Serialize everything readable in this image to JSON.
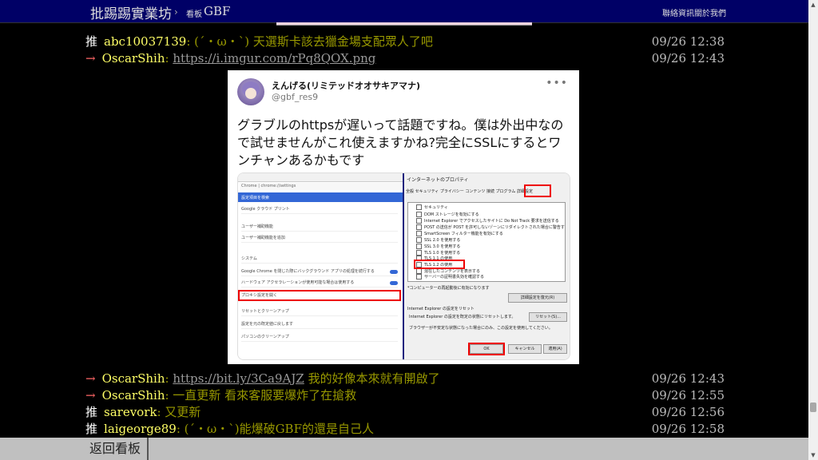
{
  "topbar": {
    "board_title": "批踢踢實業坊",
    "separator": "›",
    "board_label": "看板",
    "board_name": "GBF",
    "links": {
      "contact": "聯絡資訊",
      "about": "關於我們"
    }
  },
  "pushes_top": [
    {
      "tag": "推",
      "user": "abc10037139",
      "content": ": (´・ω・`) 天選斯卡該去獵金場支配眾人了吧",
      "time": "09/26 12:38"
    },
    {
      "tag": "→",
      "user": "OscarShih",
      "content": "https://i.imgur.com/rPq8QOX.png",
      "time": "09/26 12:43"
    }
  ],
  "tweet": {
    "display_name": "えんげる(リミテッドオオサキアマナ)",
    "handle": "@gbf_res9",
    "more_icon": "more-horizontal-icon",
    "text": "グラブルのhttpsが遅いって話題ですね。僕は外出中なので試せませんがこれ使えますかね?完全にSSLにするとワンチャンあるかもです",
    "screenshot": {
      "left_url": "Chrome | chrome://settings",
      "left_rows": [
        "設定項目を検索",
        "Google クラウド プリント",
        "ユーザー補助機能",
        "ユーザー補助機能を追加",
        "システム",
        "Google Chrome を閉じた際にバックグラウンド アプリの処理を続行する",
        "ハードウェア アクセラレーションが使用可能な場合は使用する",
        "プロキシ設定を開く",
        "リセットとクリーンアップ",
        "設定を元の既定値に戻します",
        "パソコンのクリーンアップ"
      ],
      "dialog_title": "インターネットのプロパティ",
      "tabs": "全般  セキュリティ  プライバシー  コンテンツ  接続  プログラム  詳細設定",
      "options": [
        "セキュリティ",
        "DOM ストレージを有効にする",
        "Internet Explorer でアクセスしたサイトに Do Not Track 要求を送信する",
        "POST の送信が POST を許可しないゾーンにリダイレクトされた場合に警告する",
        "SmartScreen フィルター機能を有効にする",
        "SSL 2.0 を使用する",
        "SSL 3.0 を使用する",
        "TLS 1.0 を使用する",
        "TLS 1.1 の使用",
        "TLS 1.2 の使用",
        "混在したコンテンツを表示する",
        "サーバーの証明書失効を確認する"
      ],
      "note": "*コンピューターの再起動後に有効になります",
      "restore_button": "詳細設定を復元(R)",
      "reset_heading": "Internet Explorer の設定をリセット",
      "reset_text": "Internet Explorer の設定を既定の状態にリセットします。",
      "reset_button": "リセット(S)...",
      "reset_warning": "ブラウザーが不安定な状態になった場合にのみ、この設定を使用してください。",
      "ok_button": "OK",
      "cancel_button": "キャンセル",
      "apply_button": "適用(A)"
    }
  },
  "pushes_bottom": [
    {
      "tag": "→",
      "user": "OscarShih",
      "link": "https://bit.ly/3Ca9AJZ",
      "content": " 我的好像本來就有開啟了",
      "time": "09/26 12:43"
    },
    {
      "tag": "→",
      "user": "OscarShih",
      "content": ": 一直更新 看來客服要爆炸了在搶救",
      "time": "09/26 12:55"
    },
    {
      "tag": "推",
      "user": "sarevork",
      "content": ": 又更新",
      "time": "09/26 12:56"
    },
    {
      "tag": "推",
      "user": "laigeorge89",
      "content": ": (´・ω・`)能爆破GBF的還是自己人",
      "time": "09/26 12:58"
    }
  ],
  "bottombar": {
    "back_label": "返回看板"
  },
  "scrollbar": {
    "up": "▲",
    "down": "▼"
  },
  "colors": {
    "topbar_bg": "#000066",
    "user": "#ffff66",
    "content": "#999900",
    "arrow": "#ff6666"
  }
}
